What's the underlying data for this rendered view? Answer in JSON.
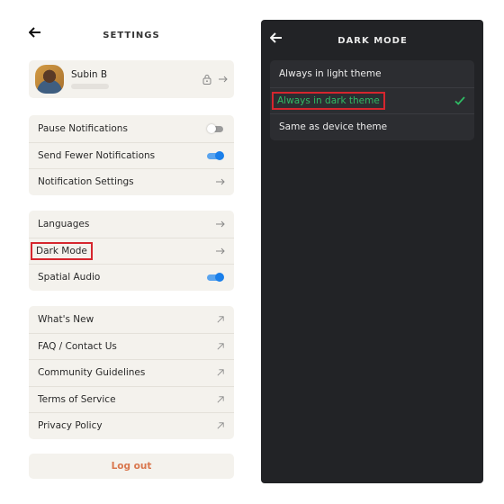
{
  "settings": {
    "title": "SETTINGS",
    "profile": {
      "name": "Subin B"
    },
    "groups": [
      [
        {
          "label": "Pause Notifications",
          "control": "toggle",
          "on": false
        },
        {
          "label": "Send Fewer Notifications",
          "control": "toggle",
          "on": true
        },
        {
          "label": "Notification Settings",
          "control": "arrow"
        }
      ],
      [
        {
          "label": "Languages",
          "control": "arrow"
        },
        {
          "label": "Dark Mode",
          "control": "arrow",
          "highlighted": true
        },
        {
          "label": "Spatial Audio",
          "control": "toggle",
          "on": true
        }
      ],
      [
        {
          "label": "What's New",
          "control": "external"
        },
        {
          "label": "FAQ / Contact Us",
          "control": "external"
        },
        {
          "label": "Community Guidelines",
          "control": "external"
        },
        {
          "label": "Terms of Service",
          "control": "external"
        },
        {
          "label": "Privacy Policy",
          "control": "external"
        }
      ]
    ],
    "logout_label": "Log out"
  },
  "dark_mode": {
    "title": "DARK MODE",
    "options": [
      {
        "label": "Always in light theme",
        "selected": false
      },
      {
        "label": "Always in dark theme",
        "selected": true
      },
      {
        "label": "Same as device theme",
        "selected": false
      }
    ]
  },
  "colors": {
    "accent_green": "#2fbb64",
    "toggle_blue": "#1a7fea",
    "logout": "#d9774e",
    "highlight_box": "#d6262e",
    "dark_bg": "#222326"
  }
}
